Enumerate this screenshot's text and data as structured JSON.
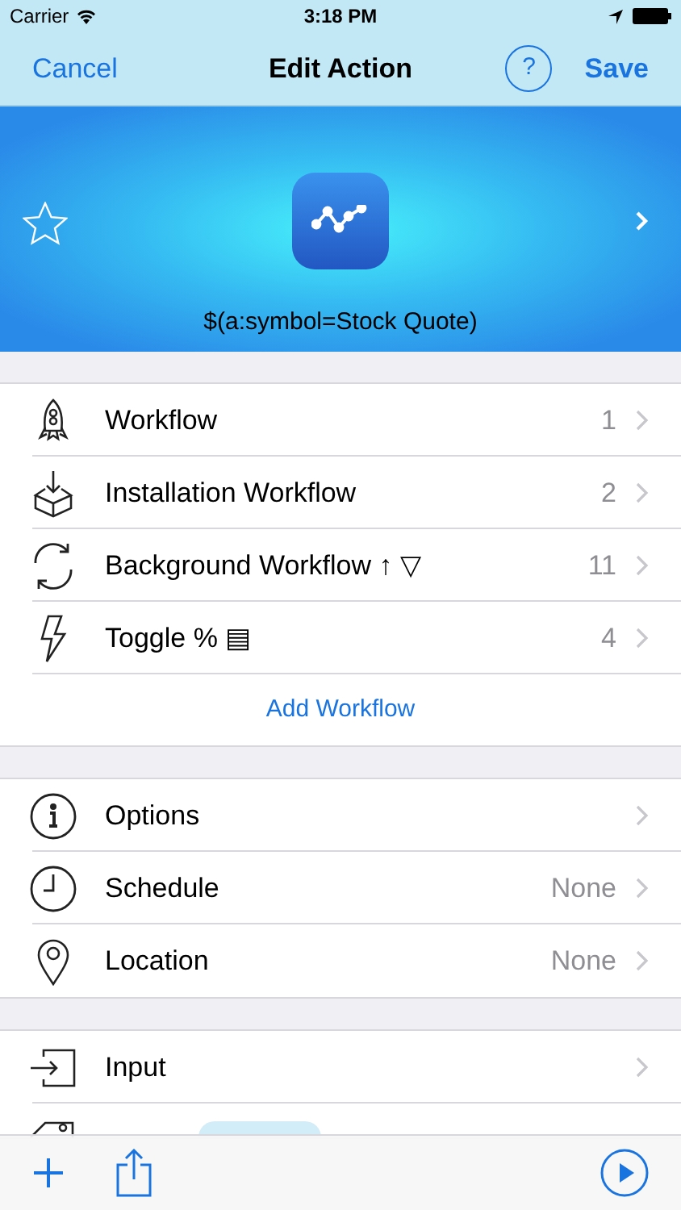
{
  "status_bar": {
    "carrier": "Carrier",
    "time": "3:18 PM"
  },
  "nav": {
    "cancel": "Cancel",
    "title": "Edit Action",
    "help": "?",
    "save": "Save"
  },
  "header": {
    "starred": false,
    "title": "$(a:symbol=Stock Quote)"
  },
  "sections": [
    {
      "rows": [
        {
          "kind": "rocket",
          "label": "Workflow",
          "detail": "1"
        },
        {
          "kind": "download",
          "label": "Installation Workflow",
          "detail": "2"
        },
        {
          "kind": "sync",
          "label": "Background Workflow ↑ ▽",
          "detail": "11"
        },
        {
          "kind": "bolt",
          "label": "Toggle % ▤",
          "detail": "4"
        }
      ],
      "link": "Add Workflow"
    },
    {
      "rows": [
        {
          "kind": "info",
          "label": "Options"
        },
        {
          "kind": "clock",
          "label": "Schedule",
          "detail": "None"
        },
        {
          "kind": "pin",
          "label": "Location",
          "detail": "None"
        }
      ]
    },
    {
      "rows": [
        {
          "kind": "input",
          "label": "Input"
        },
        {
          "kind": "tag"
        }
      ]
    }
  ]
}
